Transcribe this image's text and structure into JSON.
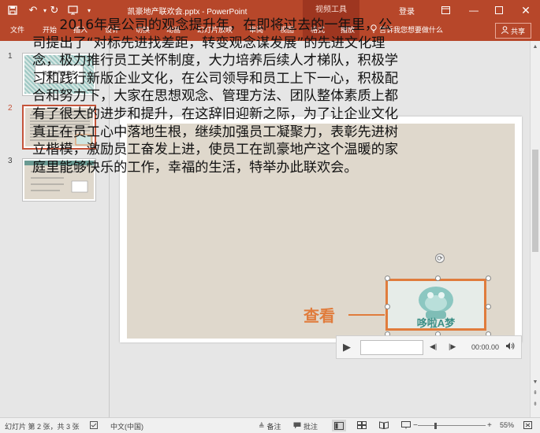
{
  "titlebar": {
    "doc_title": "凯豪地产联欢会.pptx - PowerPoint",
    "contextual_group": "视频工具",
    "login": "登录"
  },
  "ribbon": {
    "tabs": [
      "文件",
      "开始",
      "插入",
      "设计",
      "切换",
      "动画",
      "幻灯片放映",
      "审阅",
      "视图",
      "格式",
      "播放"
    ],
    "tell_me": "告诉我您想要做什么",
    "share": "共享"
  },
  "thumbnails": {
    "numbers": [
      "1",
      "2",
      "3"
    ],
    "slide1_title": "凯豪地产联欢会",
    "selected_index": 2
  },
  "slide": {
    "body_text": "2016年是公司的观念提升年，在即将过去的一年里，公司提出了“对标先进找差距，转变观念谋发展”的先进文化理念，极力推行员工关怀制度，大力培养后续人才梯队，积极学习和践行新版企业文化，在公司领导和员工上下一心，积极配合和努力下，大家在思想观念、管理方法、团队整体素质上都有了很大的进步和提升，在这辞旧迎新之际，为了让企业文化真正在员工心中落地生根，继续加强员工凝聚力，表彰先进树立楷模，激励员工奋发上进，使员工在凯豪地产这个温暖的家庭里能够快乐的工作，幸福的生活，特举办此联欢会。",
    "video_caption": "哆啦A梦",
    "callout": "查看"
  },
  "media": {
    "time": "00:00.00"
  },
  "statusbar": {
    "slide_info": "幻灯片 第 2 张，共 3 张",
    "language": "中文(中国)",
    "notes": "备注",
    "comments": "批注",
    "zoom": "55%",
    "zoom_fraction": 0.55
  },
  "colors": {
    "brand": "#b7472a",
    "accent_orange": "#e07c3c",
    "slide_bg": "#dfd8cc"
  }
}
